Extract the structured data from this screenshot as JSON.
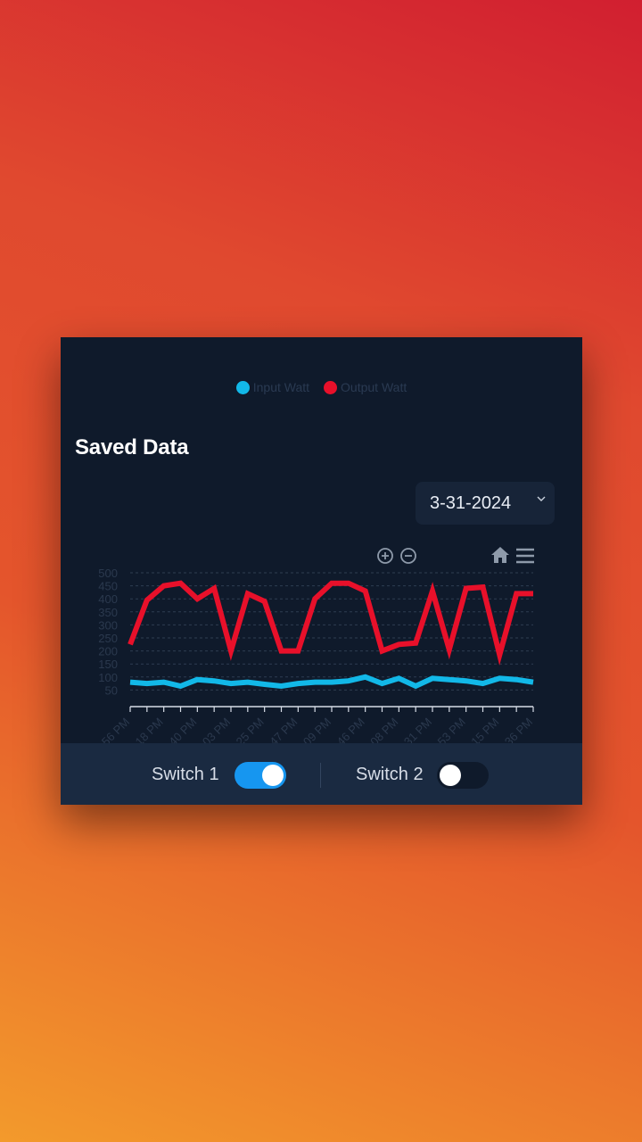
{
  "card": {
    "title": "Saved Data",
    "date_value": "3-31-2024"
  },
  "legend": [
    {
      "label": "Input Watt",
      "color": "#12b8e8"
    },
    {
      "label": "Output Watt",
      "color": "#e8102a"
    }
  ],
  "toolbar": {
    "icons": [
      "zoom-in-icon",
      "zoom-out-icon",
      "home-icon",
      "menu-icon"
    ]
  },
  "chart_data": {
    "type": "line",
    "ylim": [
      0,
      500
    ],
    "yticks": [
      50,
      100,
      150,
      200,
      250,
      300,
      350,
      400,
      450,
      500
    ],
    "xticklabels": [
      "56 PM",
      "18 PM",
      "40 PM",
      "03 PM",
      "25 PM",
      "47 PM",
      "09 PM",
      "46 PM",
      "08 PM",
      "31 PM",
      "53 PM",
      "15 PM",
      "36 PM"
    ],
    "series": [
      {
        "name": "Input Watt",
        "color": "#12b8e8",
        "values": [
          80,
          75,
          80,
          65,
          90,
          85,
          75,
          80,
          72,
          65,
          75,
          80,
          80,
          85,
          100,
          75,
          95,
          65,
          95,
          90,
          85,
          75,
          95,
          90,
          80
        ]
      },
      {
        "name": "Output Watt",
        "color": "#e8102a",
        "values": [
          225,
          395,
          450,
          460,
          400,
          440,
          200,
          420,
          390,
          200,
          200,
          400,
          460,
          460,
          430,
          200,
          225,
          230,
          430,
          205,
          440,
          445,
          185,
          420,
          420
        ]
      }
    ]
  },
  "switches": [
    {
      "label": "Switch 1",
      "on": true,
      "on_color": "#1696f0"
    },
    {
      "label": "Switch 2",
      "on": false,
      "off_color": "#0f1a2b"
    }
  ]
}
